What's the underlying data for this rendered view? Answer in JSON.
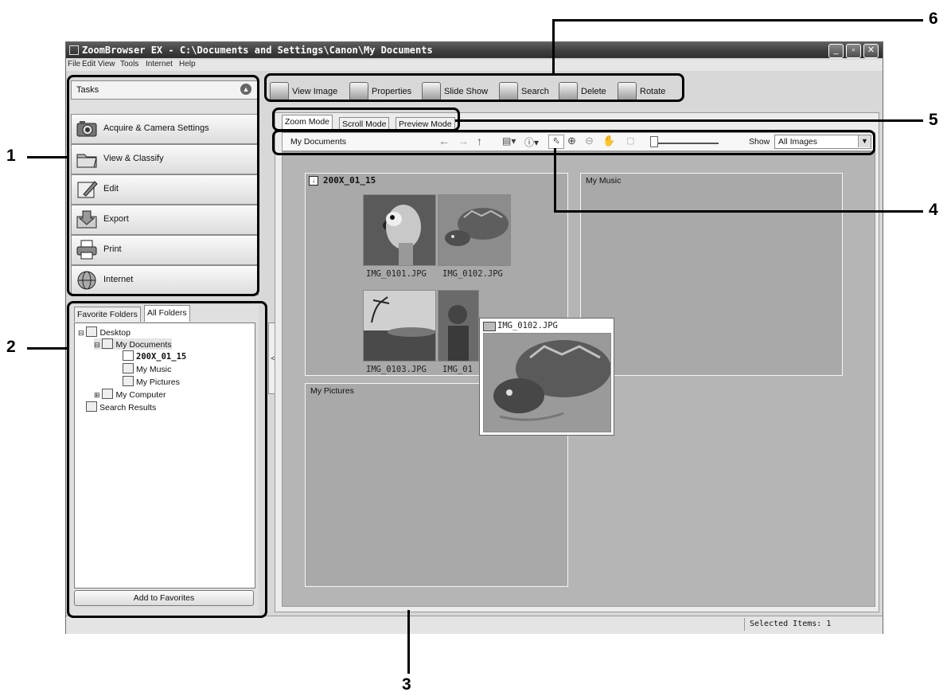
{
  "window": {
    "title": "ZoomBrowser EX  -  C:\\Documents and Settings\\Canon\\My Documents",
    "controls": [
      "_",
      "▫",
      "✕"
    ]
  },
  "menu": [
    "File",
    "Edit",
    "View",
    "Tools",
    "Internet",
    "Help"
  ],
  "tasks": {
    "header": "Tasks",
    "items": [
      {
        "label": "Acquire & Camera Settings",
        "icon": "camera-icon"
      },
      {
        "label": "View & Classify",
        "icon": "folder-icon"
      },
      {
        "label": "Edit",
        "icon": "edit-icon"
      },
      {
        "label": "Export",
        "icon": "export-icon"
      },
      {
        "label": "Print",
        "icon": "printer-icon"
      },
      {
        "label": "Internet",
        "icon": "globe-icon"
      }
    ]
  },
  "folders": {
    "tabs": [
      "Favorite Folders",
      "All Folders"
    ],
    "active_tab": "All Folders",
    "tree": [
      {
        "label": "Desktop",
        "level": 0,
        "icon": "desktop-icon"
      },
      {
        "label": "My Documents",
        "level": 1,
        "icon": "folder-icon"
      },
      {
        "label": "200X_01_15",
        "level": 2,
        "icon": "download-folder-icon"
      },
      {
        "label": "My Music",
        "level": 2,
        "icon": "music-folder-icon"
      },
      {
        "label": "My Pictures",
        "level": 2,
        "icon": "pictures-folder-icon"
      },
      {
        "label": "My Computer",
        "level": 1,
        "icon": "computer-icon"
      },
      {
        "label": "Search Results",
        "level": 0,
        "icon": "search-results-icon"
      }
    ],
    "add_button": "Add to Favorites"
  },
  "toolbar": [
    {
      "label": "View Image",
      "icon": "view-image-icon"
    },
    {
      "label": "Properties",
      "icon": "properties-icon"
    },
    {
      "label": "Slide Show",
      "icon": "slideshow-icon"
    },
    {
      "label": "Search",
      "icon": "search-icon"
    },
    {
      "label": "Delete",
      "icon": "trash-icon"
    },
    {
      "label": "Rotate",
      "icon": "rotate-icon"
    }
  ],
  "modes": [
    "Zoom Mode",
    "Scroll Mode",
    "Preview Mode"
  ],
  "active_mode": "Zoom Mode",
  "nav": {
    "location": "My Documents",
    "show_label": "Show",
    "show_value": "All Images"
  },
  "canvas": {
    "folders": [
      {
        "name": "200X_01_15"
      },
      {
        "name": "My Music"
      },
      {
        "name": "My Pictures"
      }
    ],
    "images": [
      "IMG_0101.JPG",
      "IMG_0102.JPG",
      "IMG_0103.JPG",
      "IMG_01"
    ],
    "preview_title": "IMG_0102.JPG"
  },
  "status": {
    "selected": "Selected Items: 1"
  },
  "callouts": [
    "1",
    "2",
    "3",
    "4",
    "5",
    "6"
  ]
}
